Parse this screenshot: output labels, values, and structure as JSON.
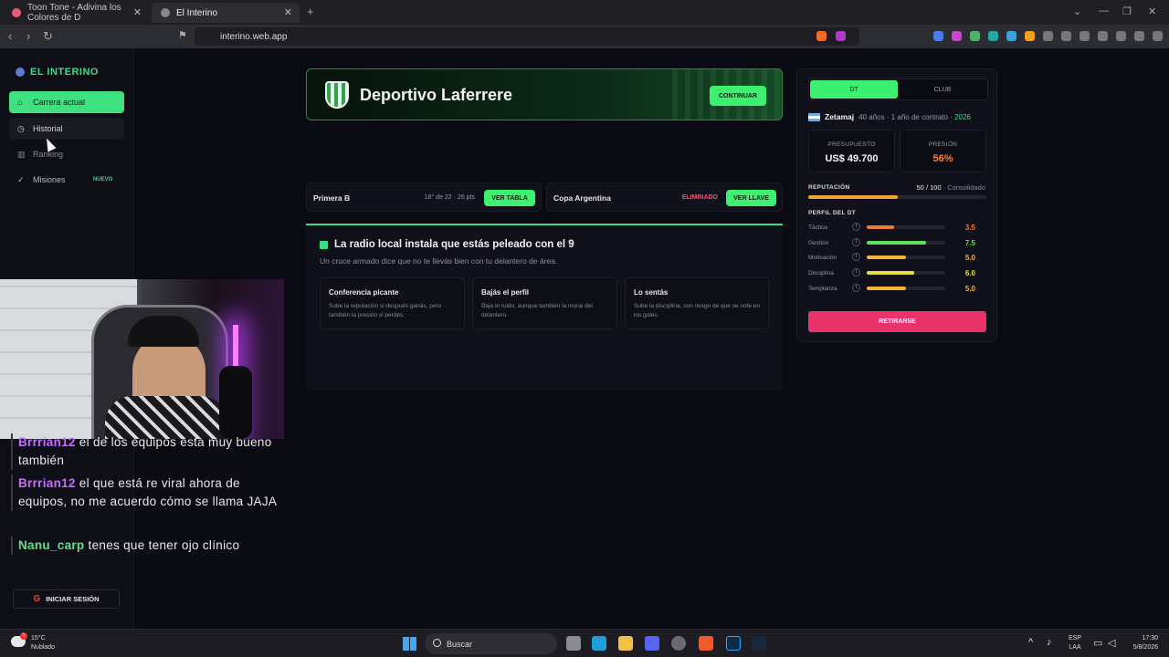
{
  "browser": {
    "tabs": [
      {
        "title": "Toon Tone - Adivina los Colores de D",
        "active": false
      },
      {
        "title": "El Interino",
        "active": true
      }
    ],
    "new_tab_symbol": "+",
    "url": "interino.web.app"
  },
  "sidebar": {
    "brand": "EL INTERINO",
    "items": [
      {
        "label": "Carrera actual",
        "icon": "home-icon",
        "state": "active"
      },
      {
        "label": "Historial",
        "icon": "clock-icon",
        "state": "hover"
      },
      {
        "label": "Ranking",
        "icon": "bar-chart-icon",
        "state": "normal"
      },
      {
        "label": "Misiones",
        "icon": "check-circle-icon",
        "state": "normal",
        "badge": "NUEVO"
      }
    ],
    "login": "INICIAR SESIÓN"
  },
  "club": {
    "name": "Deportivo Laferrere",
    "continue_label": "CONTINUAR"
  },
  "competitions": [
    {
      "name": "Primera B",
      "info": "18° de 22 · 26 pts",
      "button": "VER TABLA"
    },
    {
      "name": "Copa Argentina",
      "info": "ELIMINADO",
      "button": "VER LLAVE"
    }
  ],
  "event": {
    "title": "La radio local instala que estás peleado con el 9",
    "subtitle": "Un cruce armado dice que no te llevás bien con tu delantero de área.",
    "options": [
      {
        "title": "Conferencia picante",
        "desc": "Sube la reputación si después ganás, pero también la presión si perdés."
      },
      {
        "title": "Bajás el perfil",
        "desc": "Baja el ruido, aunque también la moral del delantero."
      },
      {
        "title": "Lo sentás",
        "desc": "Sube la disciplina, con riesgo de que se note en los goles."
      }
    ]
  },
  "panel": {
    "tabs": {
      "dt": "DT",
      "club": "CLUB"
    },
    "manager": {
      "name": "Zetamaj",
      "details": "40 años · 1 año de contrato ·",
      "year": "2026"
    },
    "budget": {
      "label": "PRESUPUESTO",
      "value": "US$ 49.700"
    },
    "pressure": {
      "label": "PRESIÓN",
      "value": "56%"
    },
    "reputation": {
      "label": "REPUTACIÓN",
      "value": "50 / 100",
      "status": "· Consolidado",
      "fraction": 0.5
    },
    "profile_label": "PERFIL DEL DT",
    "attributes": [
      {
        "name": "Táctica",
        "value": "3.5",
        "level": 0.35,
        "color": "#f07a3a"
      },
      {
        "name": "Gestión",
        "value": "7.5",
        "level": 0.75,
        "color": "#5ee05a"
      },
      {
        "name": "Motivación",
        "value": "5.0",
        "level": 0.5,
        "color": "#f0b53a"
      },
      {
        "name": "Disciplina",
        "value": "6.0",
        "level": 0.6,
        "color": "#e6e040"
      },
      {
        "name": "Templanza",
        "value": "5.0",
        "level": 0.5,
        "color": "#f0b53a"
      }
    ],
    "retire_label": "RETIRARSE"
  },
  "chat": [
    {
      "user": "Brrrian12",
      "color": "#c86bff",
      "text": "el de los equipos esta muy bueno también"
    },
    {
      "user": "Brrrian12",
      "color": "#c86bff",
      "text": "el que está re viral ahora de equipos, no me acuerdo cómo se llama JAJA"
    },
    {
      "user": "Nanu_carp",
      "color": "#5fe08a",
      "text": "tenes que tener ojo clínico"
    }
  ],
  "taskbar": {
    "weather_temp": "15°C",
    "weather_desc": "Nublado",
    "weather_badge": "1",
    "search_placeholder": "Buscar",
    "lang_top": "ESP",
    "lang_bottom": "LAA",
    "time": "17:30",
    "date": "5/8/2026"
  }
}
